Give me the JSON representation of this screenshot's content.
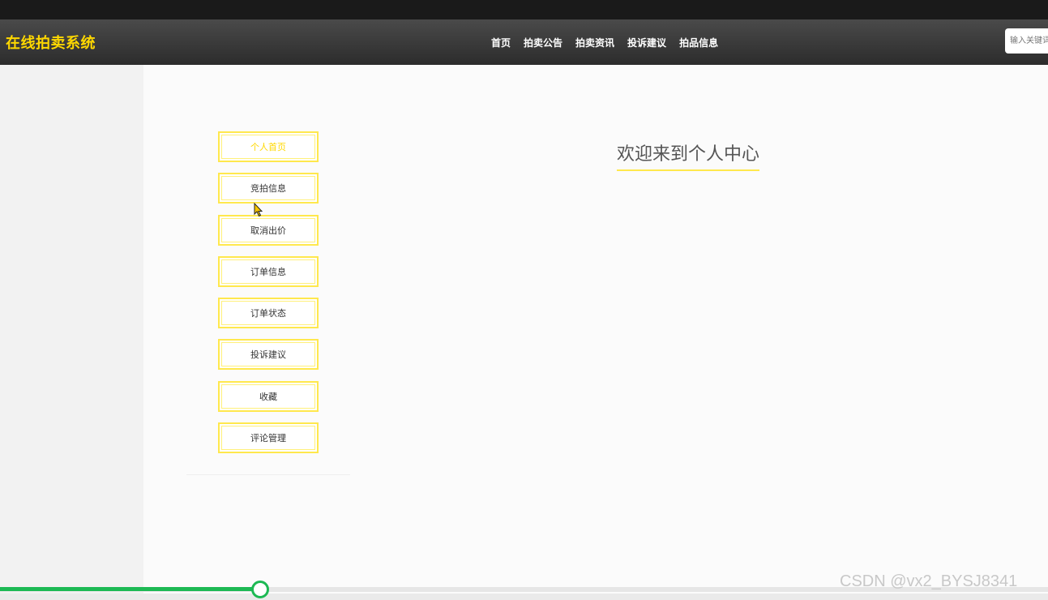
{
  "header": {
    "brand": "在线拍卖系统",
    "nav": [
      {
        "label": "首页"
      },
      {
        "label": "拍卖公告"
      },
      {
        "label": "拍卖资讯"
      },
      {
        "label": "投诉建议"
      },
      {
        "label": "拍品信息"
      }
    ],
    "search": {
      "placeholder": "输入关键词"
    }
  },
  "sidebar": {
    "items": [
      {
        "label": "个人首页",
        "active": true
      },
      {
        "label": "竞拍信息"
      },
      {
        "label": "取消出价"
      },
      {
        "label": "订单信息"
      },
      {
        "label": "订单状态"
      },
      {
        "label": "投诉建议"
      },
      {
        "label": "收藏"
      },
      {
        "label": "评论管理"
      }
    ]
  },
  "main": {
    "welcome": "欢迎来到个人中心"
  },
  "player": {
    "progress_fraction": 0.248
  },
  "watermark": "CSDN @vx2_BYSJ8341",
  "colors": {
    "accent": "#ffd800",
    "menu_border": "#ffe84d",
    "progress": "#1db954"
  }
}
